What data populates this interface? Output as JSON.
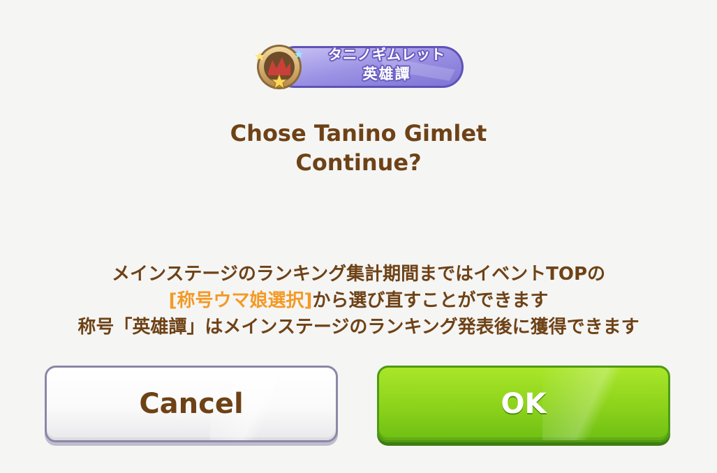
{
  "badge": {
    "line1": "タニノギムレット",
    "line2": "英雄譚",
    "icon": "trophy-stars-icon",
    "accent": "#8f86e0"
  },
  "title": {
    "line1": "Chose Tanino Gimlet",
    "line2": "Continue?"
  },
  "notice": {
    "line1": "メインステージのランキング集計期間まではイベントTOPの",
    "line2_highlight": "[称号ウマ娘選択]",
    "line2_rest": "から選び直すことができます",
    "line3": "称号「英雄譚」はメインステージのランキング発表後に獲得できます"
  },
  "buttons": {
    "cancel": "Cancel",
    "ok": "OK"
  },
  "colors": {
    "text_brown": "#6e4216",
    "highlight_orange": "#f39a25",
    "ok_green": "#8fd41c",
    "background": "#f5f5f4"
  }
}
